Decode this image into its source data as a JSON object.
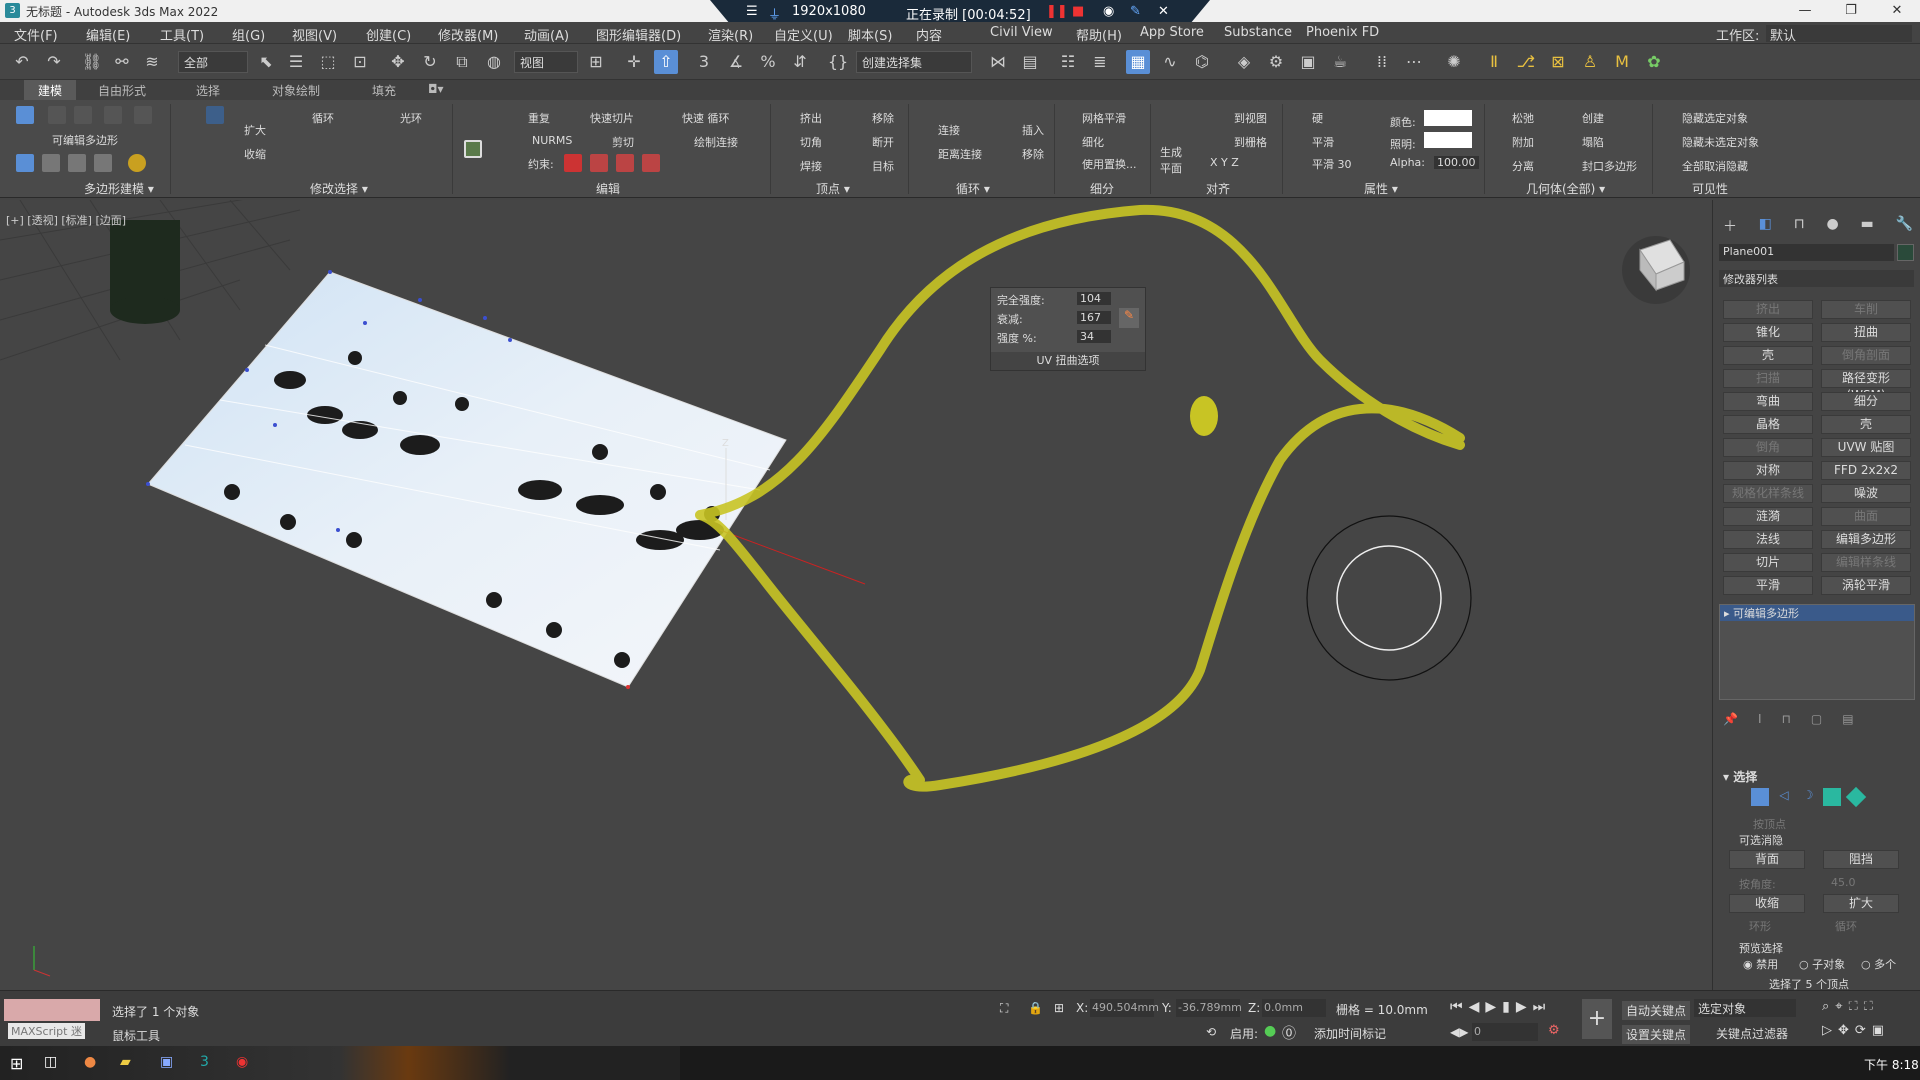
{
  "window": {
    "title": "无标题 - Autodesk 3ds Max 2022",
    "buttons": [
      "—",
      "❐",
      "✕"
    ]
  },
  "recorder": {
    "resolution": "1920x1080",
    "status": "正在录制 [00:04:52]"
  },
  "menu": {
    "items": [
      "文件(F)",
      "编辑(E)",
      "工具(T)",
      "组(G)",
      "视图(V)",
      "创建(C)",
      "修改器(M)",
      "动画(A)",
      "图形编辑器(D)",
      "渲染(R)",
      "自定义(U)",
      "脚本(S)",
      "内容",
      "Civil View",
      "帮助(H)",
      "App Store",
      "Substance",
      "Phoenix FD"
    ],
    "workspace_label": "工作区:",
    "workspace_value": "默认"
  },
  "toolbar": {
    "filter": "全部",
    "ref_coord": "视图",
    "named_sel": "创建选择集"
  },
  "ribbon_tabs": [
    "建模",
    "自由形式",
    "选择",
    "对象绘制",
    "填充"
  ],
  "ribbon": {
    "poly_modeling": "可编辑多边形",
    "poly_modeling_section": "多边形建模 ▾",
    "grow": "扩大",
    "shrink": "收缩",
    "loop": "循环",
    "ring": "光环",
    "modify_sel_section": "修改选择 ▾",
    "repeat": "重复",
    "quickslice": "快速切片",
    "quickloop": "快速 循环",
    "nurms": "NURMS",
    "cut": "剪切",
    "paintconnect": "绘制连接",
    "constraints": "约束:",
    "edit_section": "编辑",
    "extrude": "挤出",
    "remove": "移除",
    "chamfer": "切角",
    "break": "断开",
    "weld": "焊接",
    "target": "目标",
    "vertices_section": "顶点 ▾",
    "connect": "连接",
    "insert": "插入",
    "distconnect": "距离连接",
    "remove2": "移除",
    "loops_section": "循环 ▾",
    "meshsmooth": "网格平滑",
    "tessellate": "细化",
    "usedisp": "使用置换...",
    "subdiv_section": "细分",
    "genplane": "生成 平面",
    "toview": "到视图",
    "togrid": "到栅格",
    "align_section": "对齐",
    "hard": "硬",
    "smooth": "平滑",
    "smooth30": "平滑 30",
    "color": "颜色:",
    "illum": "照明:",
    "alpha": "Alpha:",
    "alpha_val": "100.00",
    "props_section": "属性 ▾",
    "relax": "松弛",
    "create": "创建",
    "attach": "附加",
    "collapse": "塌陷",
    "detach": "分离",
    "cap": "封口多边形",
    "geom_section": "几何体(全部) ▾",
    "hidesel": "隐藏选定对象",
    "hideunsel": "隐藏未选定对象",
    "unhideall": "全部取消隐藏",
    "vis_section": "可见性"
  },
  "viewport": {
    "label": "[+] [透视] [标准] [边面]",
    "popup": {
      "rows": [
        {
          "label": "完全强度:",
          "value": "104"
        },
        {
          "label": "衰减:",
          "value": "167"
        },
        {
          "label": "强度 %:",
          "value": "34"
        }
      ],
      "footer": "UV 扭曲选项"
    }
  },
  "cmdpanel": {
    "object_name": "Plane001",
    "modlist": "修改器列表",
    "buttons": [
      [
        "挤出",
        "车削"
      ],
      [
        "锥化",
        "扭曲"
      ],
      [
        "壳",
        "倒角剖面"
      ],
      [
        "扫描",
        "路径变形 (WSM)"
      ],
      [
        "弯曲",
        "细分"
      ],
      [
        "晶格",
        "壳"
      ],
      [
        "倒角",
        "UVW 贴图"
      ],
      [
        "对称",
        "FFD 2x2x2"
      ],
      [
        "规格化样条线",
        "噪波"
      ],
      [
        "涟漪",
        "曲面"
      ],
      [
        "法线",
        "编辑多边形"
      ],
      [
        "切片",
        "编辑样条线"
      ],
      [
        "平滑",
        "涡轮平滑"
      ]
    ],
    "dim": [
      [
        true,
        true
      ],
      [
        false,
        false
      ],
      [
        false,
        true
      ],
      [
        true,
        false
      ],
      [
        false,
        false
      ],
      [
        false,
        false
      ],
      [
        true,
        false
      ],
      [
        false,
        false
      ],
      [
        true,
        false
      ],
      [
        false,
        true
      ],
      [
        false,
        false
      ],
      [
        false,
        true
      ],
      [
        false,
        false
      ]
    ],
    "stack_item": "可编辑多边形",
    "sel_title": "选择",
    "by_vertex": "按顶点",
    "ignore": "可选消隐",
    "backface": "背面",
    "occluded": "阻挡",
    "by_angle": "按角度:",
    "angle": "45.0",
    "shrink": "收缩",
    "grow": "扩大",
    "ring": "环形",
    "loop": "循环",
    "preview": "预览选择",
    "off": "禁用",
    "subobj": "子对象",
    "multi": "多个",
    "count": "选择了 5 个顶点"
  },
  "status": {
    "maxscript": "MAXScript 迷",
    "selected": "选择了 1 个对象",
    "tool": "鼠标工具",
    "x_label": "X:",
    "x": "490.504mm",
    "y_label": "Y:",
    "y": "-36.789mm",
    "z_label": "Z:",
    "z": "0.0mm",
    "grid": "栅格 = 10.0mm",
    "enable": "启用:",
    "addtime": "添加时间标记",
    "autokey": "自动关键点",
    "setkey": "设置关键点",
    "selected_obj": "选定对象",
    "keyfilter": "关键点过滤器",
    "frame": "0"
  },
  "taskbar": {
    "time": "下午 8:18"
  },
  "colors": {
    "accent": "#5a8fd6",
    "stroke": "#c8c424"
  }
}
